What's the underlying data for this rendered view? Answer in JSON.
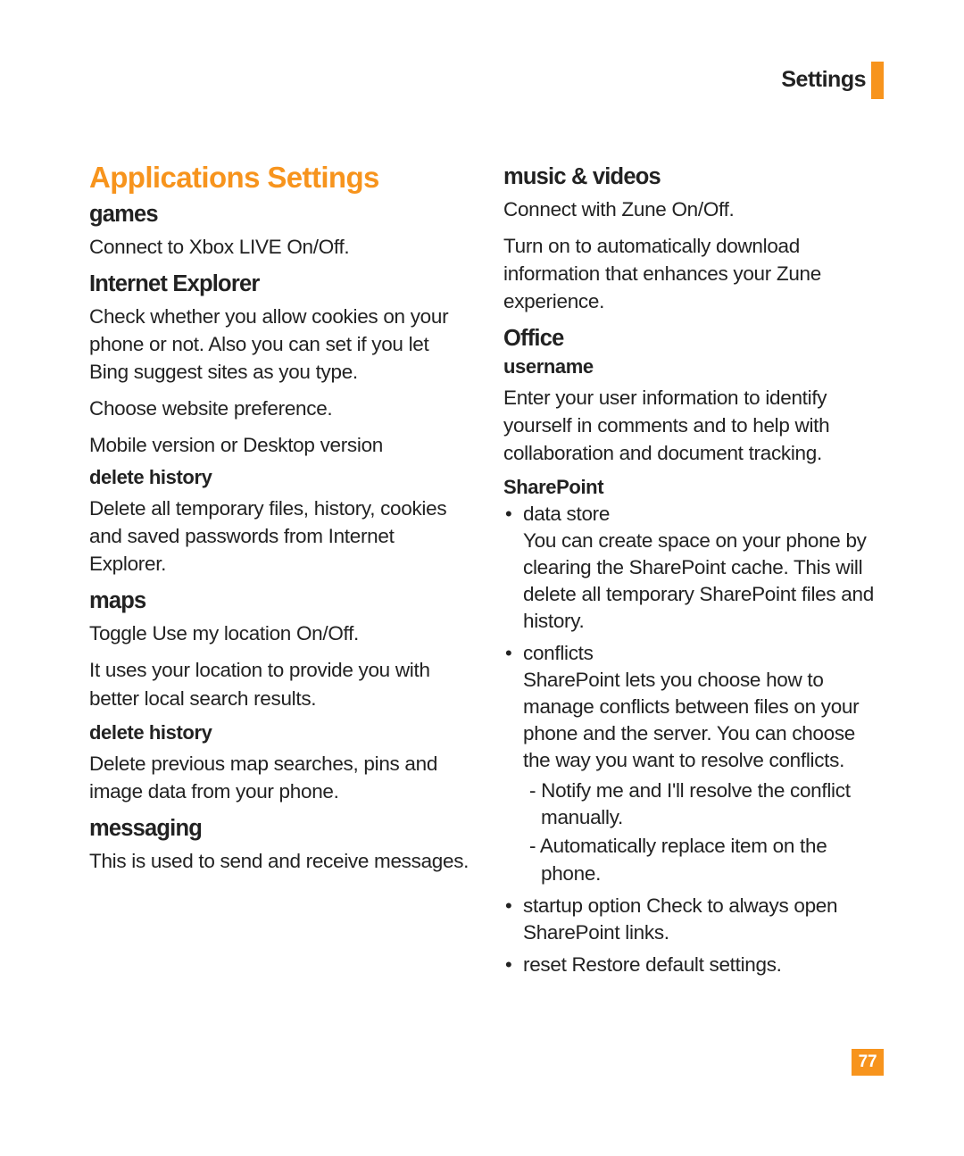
{
  "header": {
    "section": "Settings"
  },
  "page_number": "77",
  "left": {
    "title": "Applications Settings",
    "games": {
      "heading": "games",
      "body": "Connect to Xbox LIVE On/Off."
    },
    "ie": {
      "heading": "Internet Explorer",
      "p1": "Check whether you allow cookies on your phone or not. Also you can set if you let Bing suggest sites as you type.",
      "p2": "Choose website preference.",
      "p3": "Mobile version or Desktop version",
      "dh_heading": "delete history",
      "dh_body": "Delete all temporary files, history, cookies and saved passwords from Internet Explorer."
    },
    "maps": {
      "heading": "maps",
      "p1": "Toggle Use my location On/Off.",
      "p2": "It uses your location to provide you with better local search results.",
      "dh_heading": "delete history",
      "dh_body": "Delete previous map searches, pins and image data from your phone."
    },
    "messaging": {
      "heading": "messaging",
      "body": "This is used to send and receive messages."
    }
  },
  "right": {
    "music": {
      "heading": "music & videos",
      "p1": "Connect with Zune On/Off.",
      "p2": "Turn on to automatically download information that enhances your Zune experience."
    },
    "office": {
      "heading": "Office",
      "username_heading": "username",
      "username_body": "Enter your user information to identify yourself in comments and to help with collaboration and document tracking.",
      "sharepoint_heading": "SharePoint",
      "bullets": {
        "b1_lead": "data store",
        "b1_body": "You can create space on your phone by clearing the SharePoint cache. This will delete all temporary SharePoint files and history.",
        "b2_lead": "conflicts",
        "b2_body": "SharePoint lets you choose how to manage conflicts between files on your phone and the server. You can choose the way you want to resolve conflicts.",
        "b2_dash1": "- Notify me and I'll resolve the conflict manually.",
        "b2_dash2": "- Automatically replace item on the phone.",
        "b3": "startup option Check to always open SharePoint links.",
        "b4": "reset Restore default settings."
      }
    }
  }
}
